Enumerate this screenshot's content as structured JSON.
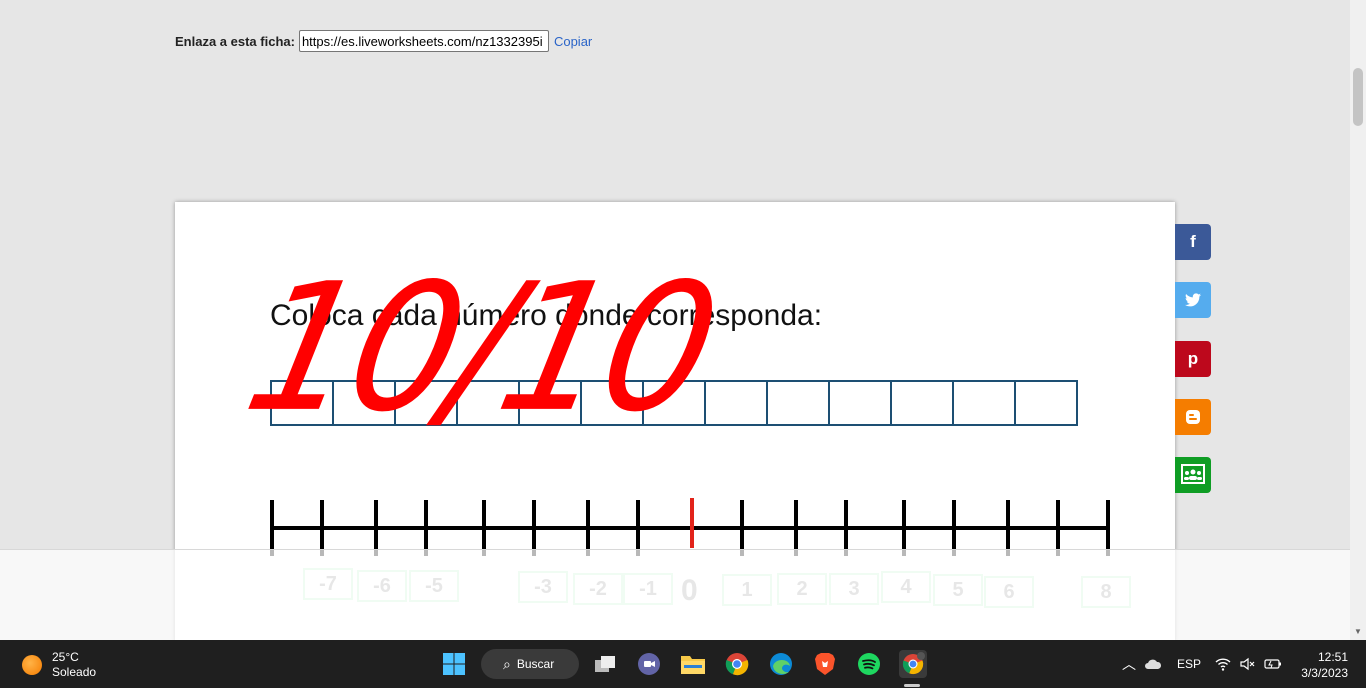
{
  "link": {
    "label": "Enlaza a esta ficha:",
    "url": "https://es.liveworksheets.com/nz1332395i",
    "copy": "Copiar"
  },
  "worksheet": {
    "instruction": "Coloca cada número donde corresponda:",
    "score": "10/10",
    "zero": "0",
    "tiles": [
      "-7",
      "-6",
      "-5",
      "-3",
      "-2",
      "-1",
      "1",
      "2",
      "3",
      "4",
      "5",
      "6",
      "8"
    ]
  },
  "social": [
    "f",
    "t",
    "p",
    "b",
    "c"
  ],
  "taskbar": {
    "temp": "25°C",
    "condition": "Soleado",
    "search": "Buscar",
    "lang": "ESP",
    "time": "12:51",
    "date": "3/3/2023"
  }
}
